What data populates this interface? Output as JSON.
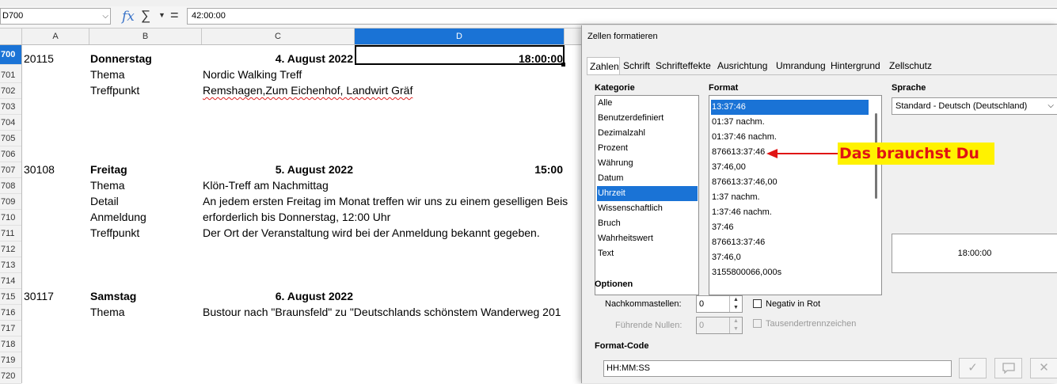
{
  "formula_bar": {
    "cell_ref": "D700",
    "formula_value": "42:00:00",
    "function_wizard_glyph": "fx",
    "sum_glyph": "∑",
    "equals_glyph": "="
  },
  "columns": [
    "A",
    "B",
    "C",
    "D"
  ],
  "selected_column": "D",
  "row_numbers": [
    "700",
    "701",
    "702",
    "703",
    "704",
    "705",
    "706",
    "707",
    "708",
    "709",
    "710",
    "711",
    "712",
    "713",
    "714",
    "715",
    "716",
    "717",
    "718",
    "719",
    "720"
  ],
  "cells": {
    "r700": {
      "a": "20115",
      "b": "Donnerstag",
      "c": "4. August 2022",
      "d": "18:00:00"
    },
    "r701": {
      "b": "Thema",
      "c": "Nordic Walking Treff"
    },
    "r702": {
      "b": "Treffpunkt",
      "c": "Remshagen,Zum Eichenhof, Landwirt Gräf"
    },
    "r707": {
      "a": "30108",
      "b": "Freitag",
      "c": "5. August 2022",
      "d": "15:00"
    },
    "r708": {
      "b": "Thema",
      "c": "Klön-Treff am Nachmittag"
    },
    "r709": {
      "b": "Detail",
      "c": "An jedem ersten Freitag im Monat treffen wir uns zu einem geselligen Beis"
    },
    "r710": {
      "b": "Anmeldung",
      "c": "erforderlich bis Donnerstag, 12:00 Uhr"
    },
    "r711": {
      "b": "Treffpunkt",
      "c": "Der Ort der Veranstaltung wird bei der Anmeldung bekannt gegeben."
    },
    "r715": {
      "a": "30117",
      "b": "Samstag",
      "c": "6. August 2022"
    },
    "r716": {
      "b": "Thema",
      "c": "Bustour nach \"Braunsfeld\" zu \"Deutschlands schönstem Wanderweg 201"
    }
  },
  "dialog": {
    "title": "Zellen formatieren",
    "tabs": [
      "Zahlen",
      "Schrift",
      "Schrifteffekte",
      "Ausrichtung",
      "Umrandung",
      "Hintergrund",
      "Zellschutz"
    ],
    "active_tab": "Zahlen",
    "category_label": "Kategorie",
    "categories": [
      "Alle",
      "Benutzerdefiniert",
      "Dezimalzahl",
      "Prozent",
      "Währung",
      "Datum",
      "Uhrzeit",
      "Wissenschaftlich",
      "Bruch",
      "Wahrheitswert",
      "Text"
    ],
    "selected_category": "Uhrzeit",
    "format_label": "Format",
    "formats": [
      "13:37:46",
      "01:37 nachm.",
      "01:37:46 nachm.",
      "876613:37:46",
      "37:46,00",
      "876613:37:46,00",
      "1:37 nachm.",
      "1:37:46 nachm.",
      "37:46",
      "876613:37:46",
      "37:46,0",
      "3155800066,000s"
    ],
    "selected_format": "13:37:46",
    "language_label": "Sprache",
    "language_value": "Standard - Deutsch (Deutschland)",
    "preview_value": "18:00:00",
    "options_label": "Optionen",
    "decimal_places_label": "Nachkommastellen:",
    "decimal_places_value": "0",
    "leading_zeros_label": "Führende Nullen:",
    "leading_zeros_value": "0",
    "negative_red_label": "Negativ in Rot",
    "thousands_sep_label": "Tausendertrennzeichen",
    "format_code_label": "Format-Code",
    "format_code_value": "HH:MM:SS"
  },
  "annotation": {
    "text": "Das brauchst Du",
    "color_text": "#e01414",
    "color_bg": "#fff200"
  },
  "colors": {
    "selection_blue": "#1a73d6"
  }
}
